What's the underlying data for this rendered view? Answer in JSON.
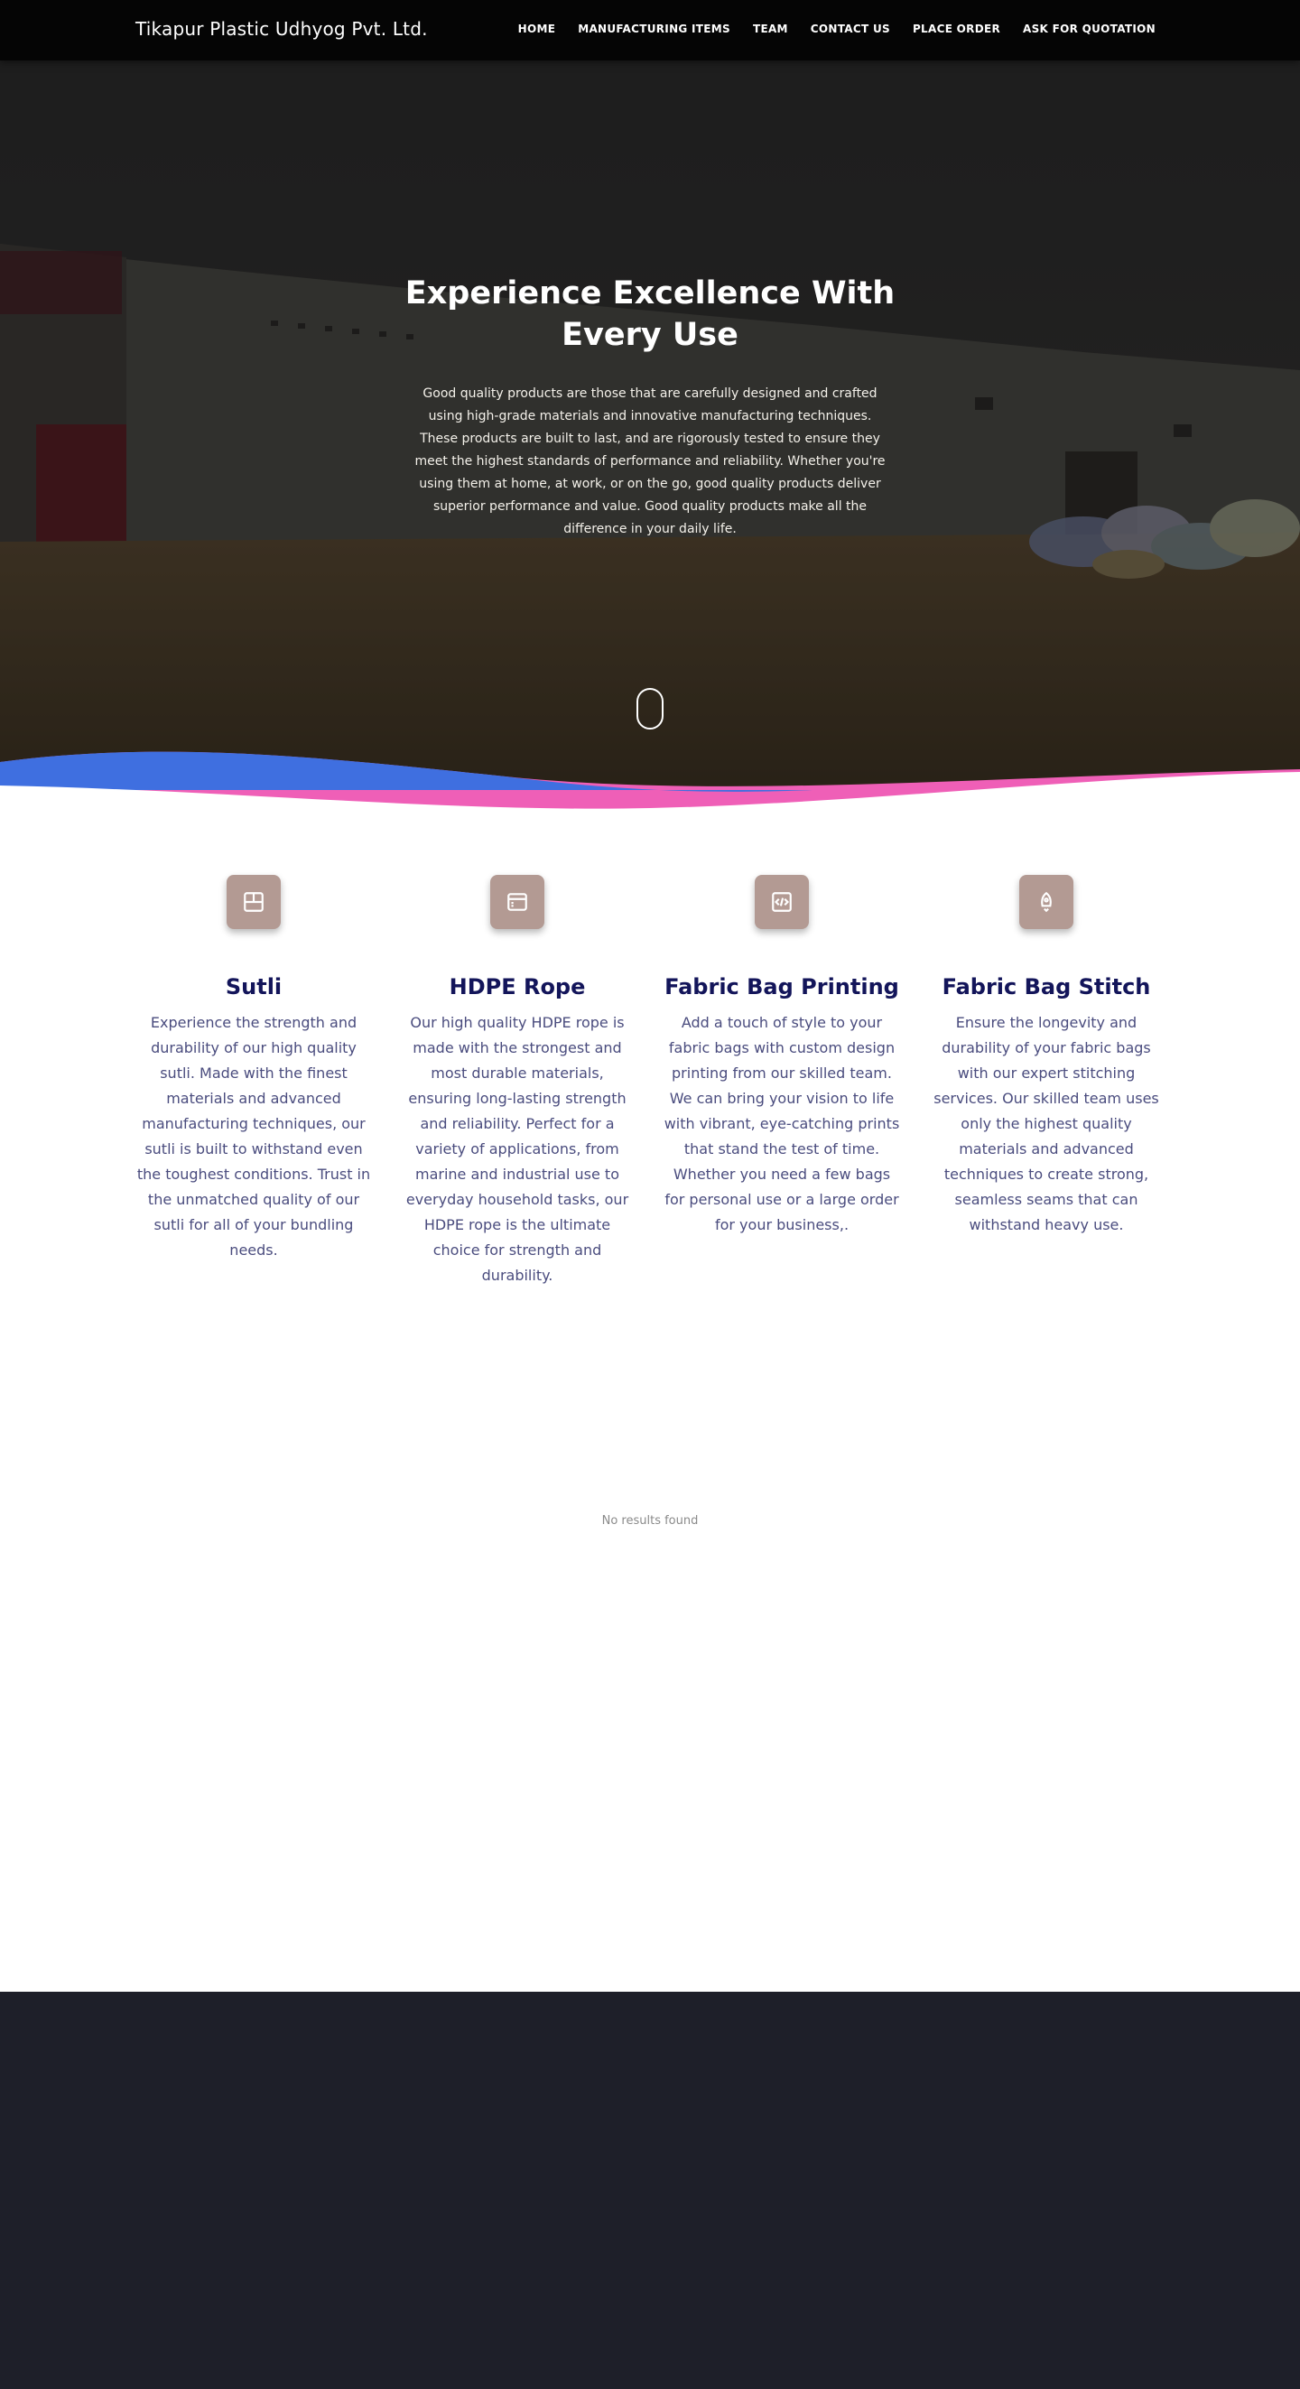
{
  "navbar": {
    "brand": "Tikapur Plastic Udhyog Pvt. Ltd.",
    "links": [
      "HOME",
      "MANUFACTURING ITEMS",
      "TEAM",
      "CONTACT US",
      "PLACE ORDER",
      "ASK FOR QUOTATION"
    ]
  },
  "hero": {
    "title": "Experience Excellence With Every Use",
    "text": "Good quality products are those that are carefully designed and crafted using high-grade materials and innovative manufacturing techniques. These products are built to last, and are rigorously tested to ensure they meet the highest standards of performance and reliability. Whether you're using them at home, at work, or on the go, good quality products deliver superior performance and value. Good quality products make all the difference in your daily life."
  },
  "services": [
    {
      "icon": "layout-icon",
      "title": "Sutli",
      "text": "Experience the strength and durability of our high quality sutli. Made with the finest materials and advanced manufacturing techniques, our sutli is built to withstand even the toughest conditions. Trust in the unmatched quality of our sutli for all of your bundling needs."
    },
    {
      "icon": "window-icon",
      "title": "HDPE Rope",
      "text": "Our high quality HDPE rope is made with the strongest and most durable materials, ensuring long-lasting strength and reliability. Perfect for a variety of applications, from marine and industrial use to everyday household tasks, our HDPE rope is the ultimate choice for strength and durability."
    },
    {
      "icon": "code-icon",
      "title": "Fabric Bag Printing",
      "text": "Add a touch of style to your fabric bags with custom design printing from our skilled team. We can bring your vision to life with vibrant, eye-catching prints that stand the test of time. Whether you need a few bags for personal use or a large order for your business,."
    },
    {
      "icon": "rocket-icon",
      "title": "Fabric Bag Stitch",
      "text": "Ensure the longevity and durability of your fabric bags with our expert stitching services. Our skilled team uses only the highest quality materials and advanced techniques to create strong, seamless seams that can withstand heavy use."
    }
  ],
  "no_results": "No results found",
  "colors": {
    "navbar": "#050505",
    "icon_bg": "#b39a93",
    "heading": "#13155a",
    "body_text": "#4a4c7e",
    "wave_blue": "#3f6fe0",
    "wave_pink": "#ef5fb7",
    "footer": "#1e1f29"
  }
}
